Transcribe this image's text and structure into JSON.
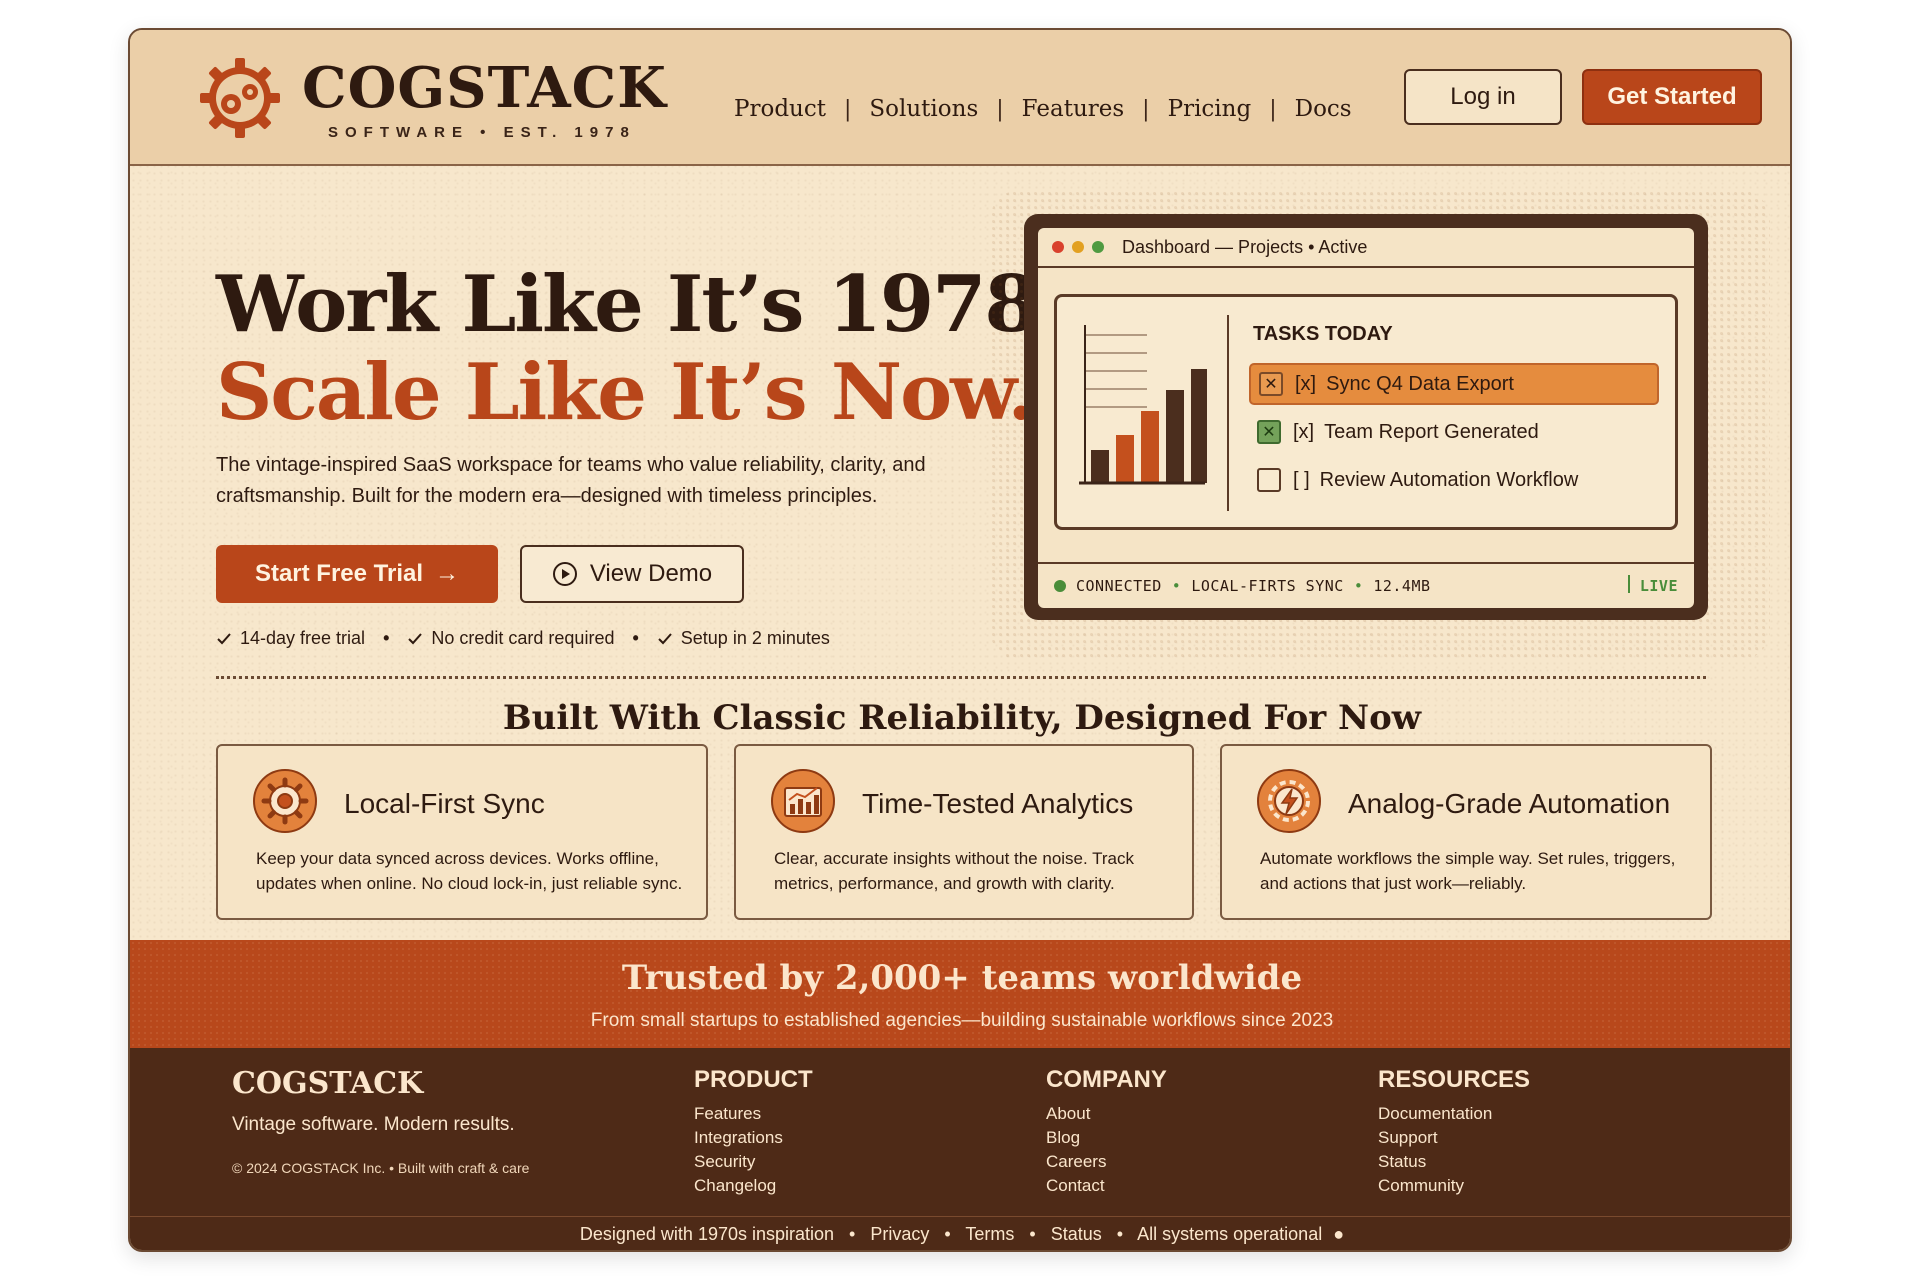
{
  "brand": {
    "name": "COGSTACK",
    "tagline": "SOFTWARE • EST. 1978"
  },
  "nav": {
    "items": [
      {
        "label": "Product"
      },
      {
        "label": "Solutions"
      },
      {
        "label": "Features"
      },
      {
        "label": "Pricing"
      },
      {
        "label": "Docs"
      }
    ],
    "separator": "|",
    "login": "Log in",
    "cta": "Get Started"
  },
  "hero": {
    "line1": "Work Like It’s 1978.",
    "line2": "Scale Like It’s Now.",
    "subtitle": "The vintage-inspired SaaS workspace for teams who value reliability, clarity, and craftsmanship. Built for the modern era—designed with timeless principles.",
    "primary_cta": "Start Free Trial",
    "primary_cta_icon": "→",
    "secondary_cta": "View Demo",
    "perks": [
      "14-day free trial",
      "No credit card required",
      "Setup in 2 minutes"
    ],
    "perk_separator": "•"
  },
  "dashboard": {
    "title": "Dashboard — Projects • Active",
    "tasks_heading": "TASKS TODAY",
    "tasks": [
      {
        "mark": "[x]",
        "label": "Sync Q4 Data Export",
        "checked": true,
        "highlighted": true
      },
      {
        "mark": "[x]",
        "label": "Team Report Generated",
        "checked": true,
        "highlighted": false
      },
      {
        "mark": "[ ]",
        "label": "Review Automation Workflow",
        "checked": false,
        "highlighted": false
      }
    ],
    "chart_bars": [
      0.22,
      0.32,
      0.48,
      0.62,
      0.76
    ],
    "status": {
      "connected": "CONNECTED",
      "sync": "LOCAL-FIRTS SYNC",
      "size": "12.4MB",
      "live": "LIVE",
      "separator": "•"
    }
  },
  "features": {
    "heading": "Built With Classic Reliability, Designed For Now",
    "cards": [
      {
        "icon": "gear-icon",
        "title": "Local-First Sync",
        "desc": "Keep your data synced across devices. Works offline, updates when online. No cloud lock-in, just reliable sync."
      },
      {
        "icon": "analytics-chart-icon",
        "title": "Time-Tested Analytics",
        "desc": "Clear, accurate insights without the noise. Track metrics, performance, and growth with clarity."
      },
      {
        "icon": "automation-bolt-icon",
        "title": "Analog-Grade Automation",
        "desc": "Automate workflows the simple way. Set rules, triggers, and actions that just work—reliably."
      }
    ]
  },
  "trust": {
    "title": "Trusted by 2,000+ teams worldwide",
    "subtitle": "From small startups to established agencies—building sustainable workflows since 2023"
  },
  "footer": {
    "brand": "COGSTACK",
    "tagline": "Vintage software. Modern results.",
    "copyright": "© 2024 COGSTACK Inc. • Built with craft & care",
    "columns": [
      {
        "heading": "PRODUCT",
        "links": [
          "Features",
          "Integrations",
          "Security",
          "Changelog"
        ]
      },
      {
        "heading": "COMPANY",
        "links": [
          "About",
          "Blog",
          "Careers",
          "Contact"
        ]
      },
      {
        "heading": "RESOURCES",
        "links": [
          "Documentation",
          "Support",
          "Status",
          "Community"
        ]
      }
    ],
    "bottom": [
      "Designed with 1970s inspiration",
      "Privacy",
      "Terms",
      "Status",
      "All systems operational"
    ],
    "bottom_separator": "•",
    "status_dot": "●"
  },
  "colors": {
    "accent": "#b9461a",
    "dark_brown": "#2e1a10",
    "footer_bg": "#4e2a17",
    "parchment": "#f7e7cc",
    "status_green": "#4a8d3a",
    "task_highlight": "#e58c3e"
  }
}
